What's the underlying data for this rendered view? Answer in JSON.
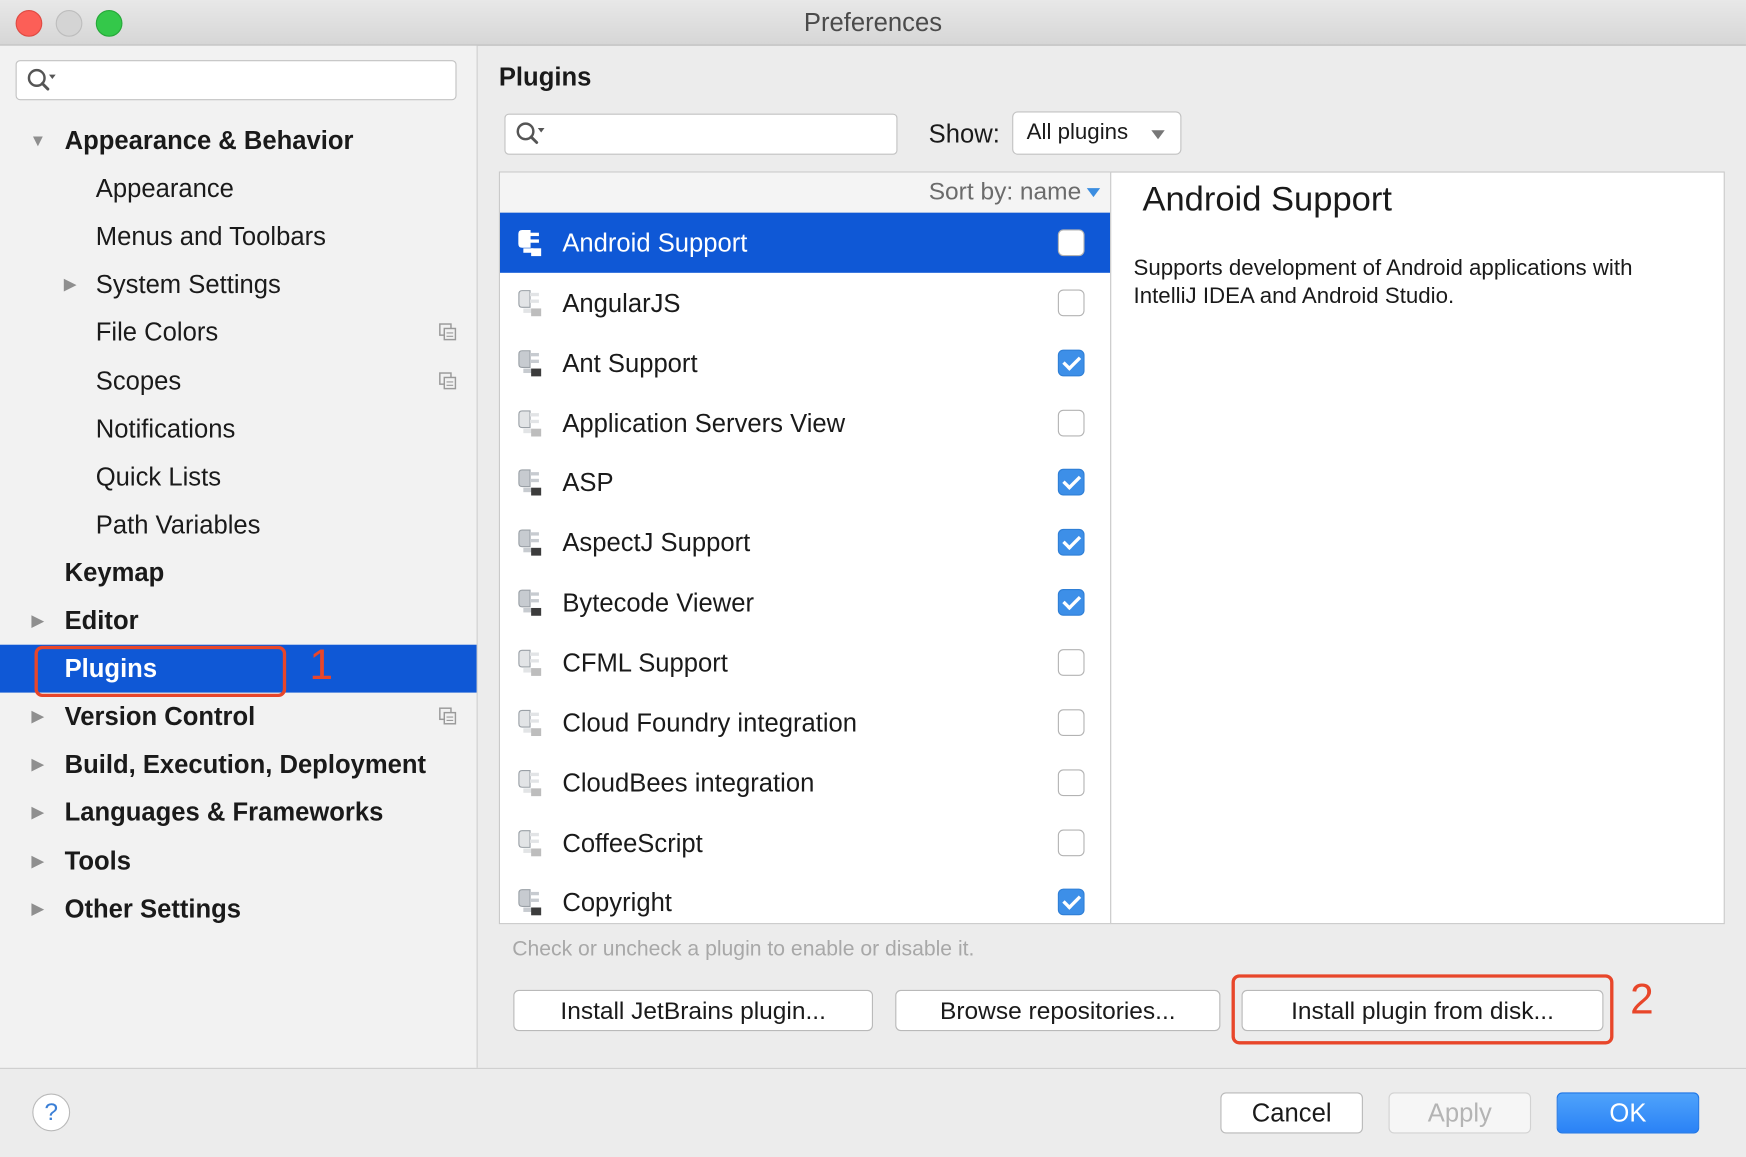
{
  "window": {
    "title": "Preferences"
  },
  "sidebar": {
    "search_placeholder": "",
    "items": [
      {
        "label": "Appearance & Behavior",
        "level": 0,
        "bold": true,
        "expanded": true,
        "has_children": true,
        "copy_icon": false
      },
      {
        "label": "Appearance",
        "level": 1,
        "bold": false,
        "has_children": false,
        "copy_icon": false
      },
      {
        "label": "Menus and Toolbars",
        "level": 1,
        "bold": false,
        "has_children": false,
        "copy_icon": false
      },
      {
        "label": "System Settings",
        "level": 1,
        "bold": false,
        "has_children": true,
        "copy_icon": false
      },
      {
        "label": "File Colors",
        "level": 1,
        "bold": false,
        "has_children": false,
        "copy_icon": true
      },
      {
        "label": "Scopes",
        "level": 1,
        "bold": false,
        "has_children": false,
        "copy_icon": true
      },
      {
        "label": "Notifications",
        "level": 1,
        "bold": false,
        "has_children": false,
        "copy_icon": false
      },
      {
        "label": "Quick Lists",
        "level": 1,
        "bold": false,
        "has_children": false,
        "copy_icon": false
      },
      {
        "label": "Path Variables",
        "level": 1,
        "bold": false,
        "has_children": false,
        "copy_icon": false
      },
      {
        "label": "Keymap",
        "level": 0,
        "bold": true,
        "has_children": false,
        "copy_icon": false
      },
      {
        "label": "Editor",
        "level": 0,
        "bold": true,
        "has_children": true,
        "copy_icon": false
      },
      {
        "label": "Plugins",
        "level": 0,
        "bold": true,
        "has_children": false,
        "selected": true,
        "copy_icon": false
      },
      {
        "label": "Version Control",
        "level": 0,
        "bold": true,
        "has_children": true,
        "copy_icon": true
      },
      {
        "label": "Build, Execution, Deployment",
        "level": 0,
        "bold": true,
        "has_children": true,
        "copy_icon": false
      },
      {
        "label": "Languages & Frameworks",
        "level": 0,
        "bold": true,
        "has_children": true,
        "copy_icon": false
      },
      {
        "label": "Tools",
        "level": 0,
        "bold": true,
        "has_children": true,
        "copy_icon": false
      },
      {
        "label": "Other Settings",
        "level": 0,
        "bold": true,
        "has_children": true,
        "copy_icon": false
      }
    ]
  },
  "main": {
    "title": "Plugins",
    "search_placeholder": "",
    "show_label": "Show:",
    "show_value": "All plugins",
    "sort_label": "Sort by: name",
    "plugins": [
      {
        "name": "Android Support",
        "checked": false,
        "selected": true,
        "enabled_icon": true
      },
      {
        "name": "AngularJS",
        "checked": false,
        "enabled_icon": false
      },
      {
        "name": "Ant Support",
        "checked": true,
        "enabled_icon": true
      },
      {
        "name": "Application Servers View",
        "checked": false,
        "enabled_icon": false
      },
      {
        "name": "ASP",
        "checked": true,
        "enabled_icon": true
      },
      {
        "name": "AspectJ Support",
        "checked": true,
        "enabled_icon": true
      },
      {
        "name": "Bytecode Viewer",
        "checked": true,
        "enabled_icon": true
      },
      {
        "name": "CFML Support",
        "checked": false,
        "enabled_icon": false
      },
      {
        "name": "Cloud Foundry integration",
        "checked": false,
        "enabled_icon": false
      },
      {
        "name": "CloudBees integration",
        "checked": false,
        "enabled_icon": false
      },
      {
        "name": "CoffeeScript",
        "checked": false,
        "enabled_icon": false
      },
      {
        "name": "Copyright",
        "checked": true,
        "enabled_icon": true
      }
    ],
    "detail": {
      "title": "Android Support",
      "description": "Supports development of Android applications with IntelliJ IDEA and Android Studio."
    },
    "hint": "Check or uncheck a plugin to enable or disable it.",
    "buttons": {
      "install_jetbrains": "Install JetBrains plugin...",
      "browse_repos": "Browse repositories...",
      "install_disk": "Install plugin from disk..."
    }
  },
  "annotations": {
    "one": "1",
    "two": "2"
  },
  "footer": {
    "help": "?",
    "cancel": "Cancel",
    "apply": "Apply",
    "ok": "OK"
  },
  "colors": {
    "selection": "#0f58d6",
    "annotation": "#e8462a",
    "primary_button": "#2a82f6",
    "checkbox_checked": "#3d8fe8"
  },
  "icons": {
    "search": "search-icon",
    "plugin": "plugin-icon",
    "copy": "copy-icon",
    "help": "help-icon"
  }
}
